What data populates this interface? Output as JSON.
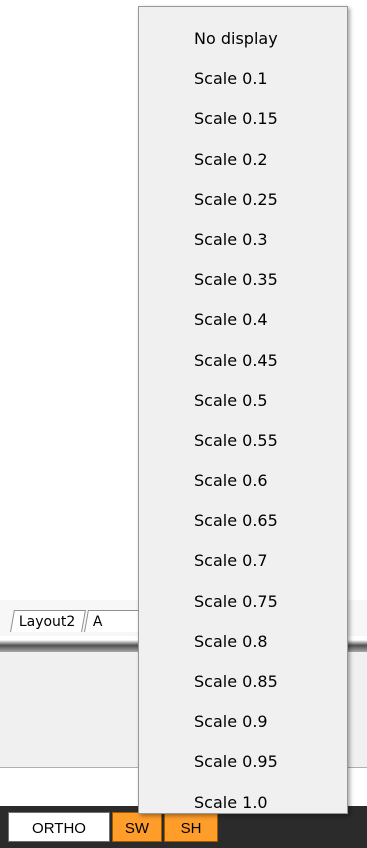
{
  "tabs": [
    {
      "label": "Layout2"
    },
    {
      "label": "A"
    }
  ],
  "status_bar": {
    "ortho_label": "ORTHO",
    "sw_label": "SW",
    "sh_label": "SH"
  },
  "dropdown": {
    "items": [
      {
        "label": "No display"
      },
      {
        "label": "Scale 0.1"
      },
      {
        "label": "Scale 0.15"
      },
      {
        "label": "Scale 0.2"
      },
      {
        "label": "Scale 0.25"
      },
      {
        "label": "Scale 0.3"
      },
      {
        "label": "Scale 0.35"
      },
      {
        "label": "Scale 0.4"
      },
      {
        "label": "Scale 0.45"
      },
      {
        "label": "Scale 0.5"
      },
      {
        "label": "Scale 0.55"
      },
      {
        "label": "Scale 0.6"
      },
      {
        "label": "Scale 0.65"
      },
      {
        "label": "Scale 0.7"
      },
      {
        "label": "Scale 0.75"
      },
      {
        "label": "Scale 0.8"
      },
      {
        "label": "Scale 0.85"
      },
      {
        "label": "Scale 0.9"
      },
      {
        "label": "Scale 0.95"
      },
      {
        "label": "Scale 1.0"
      }
    ]
  },
  "colors": {
    "status_active": "#ff9d2b",
    "menu_background": "#f0f0f0",
    "status_bar_background": "#2b2b2b"
  }
}
